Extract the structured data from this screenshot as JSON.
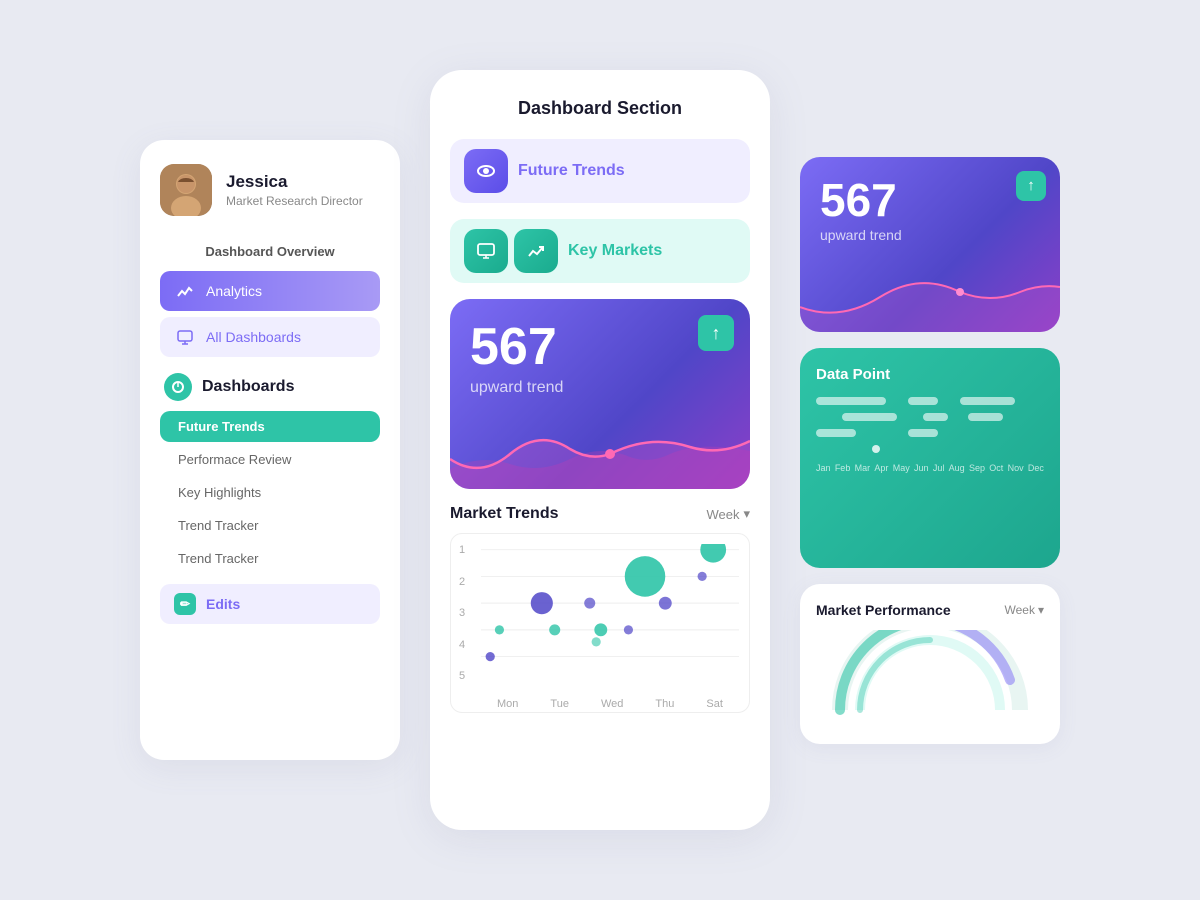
{
  "left": {
    "user": {
      "name": "Jessica",
      "role": "Market Research Director"
    },
    "overview_title": "Dashboard Overview",
    "nav_items": [
      {
        "label": "Analytics",
        "active": true
      },
      {
        "label": "All Dashboards",
        "active2": true
      }
    ],
    "dashboards_label": "Dashboards",
    "sub_items": [
      {
        "label": "Future Trends",
        "active": true
      },
      {
        "label": "Performace Review",
        "active": false
      },
      {
        "label": "Key Highlights",
        "active": false
      },
      {
        "label": "Trend Tracker",
        "active": false
      },
      {
        "label": "Trend Tracker",
        "active": false
      }
    ],
    "edits_label": "Edits"
  },
  "center": {
    "title": "Dashboard Section",
    "menu_items": [
      {
        "label": "Future Trends",
        "color": "purple"
      },
      {
        "label": "Key Markets",
        "color": "teal"
      }
    ],
    "stats": {
      "number": "567",
      "label": "upward trend"
    },
    "trends": {
      "title": "Market Trends",
      "period": "Week",
      "y_labels": [
        "5",
        "4",
        "3",
        "2",
        "1"
      ],
      "x_labels": [
        "Mon",
        "Tue",
        "Wed",
        "Thu",
        "Sat"
      ]
    }
  },
  "right": {
    "stats": {
      "number": "567",
      "label": "upward trend"
    },
    "data_point": {
      "title": "Data Point",
      "months": [
        "Jan",
        "Feb",
        "Mar",
        "Apr",
        "May",
        "Jun",
        "Jul",
        "Aug",
        "Sep",
        "Oct",
        "Nov",
        "Dec"
      ]
    },
    "market_perf": {
      "title": "Market Performance",
      "period": "Week"
    }
  }
}
